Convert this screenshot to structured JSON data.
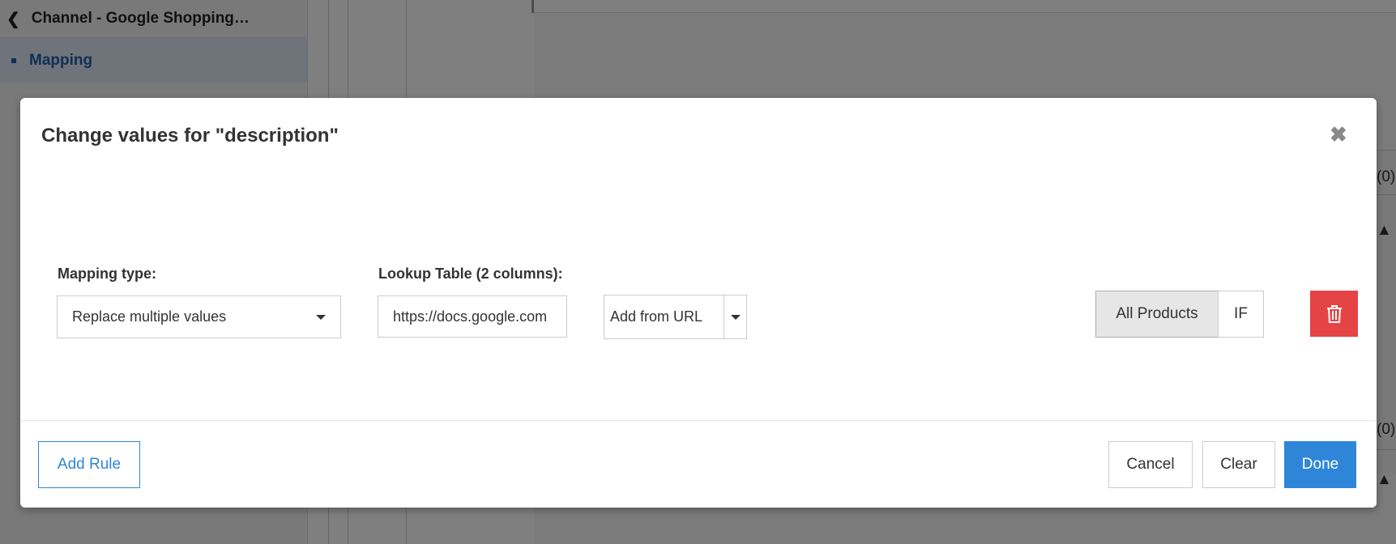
{
  "sidebar": {
    "back_label": "Channel - Google Shopping…",
    "items": [
      {
        "label": "Mapping"
      }
    ]
  },
  "background": {
    "counts": [
      "(0)",
      "(0)"
    ]
  },
  "modal": {
    "title": "Change values for \"description\"",
    "close_icon": "close-icon",
    "mapping_type": {
      "label": "Mapping type:",
      "value": "Replace multiple values"
    },
    "lookup": {
      "label": "Lookup Table (2 columns):",
      "value": "https://docs.google.com",
      "add_label": "Add from URL"
    },
    "scope": {
      "options": [
        "All Products",
        "IF"
      ],
      "selected": "All Products"
    },
    "delete_icon": "trash-icon",
    "footer": {
      "add_rule": "Add Rule",
      "cancel": "Cancel",
      "clear": "Clear",
      "done": "Done"
    }
  },
  "colors": {
    "primary": "#2f86d8",
    "danger": "#e54446",
    "link": "#1f5ea8"
  }
}
